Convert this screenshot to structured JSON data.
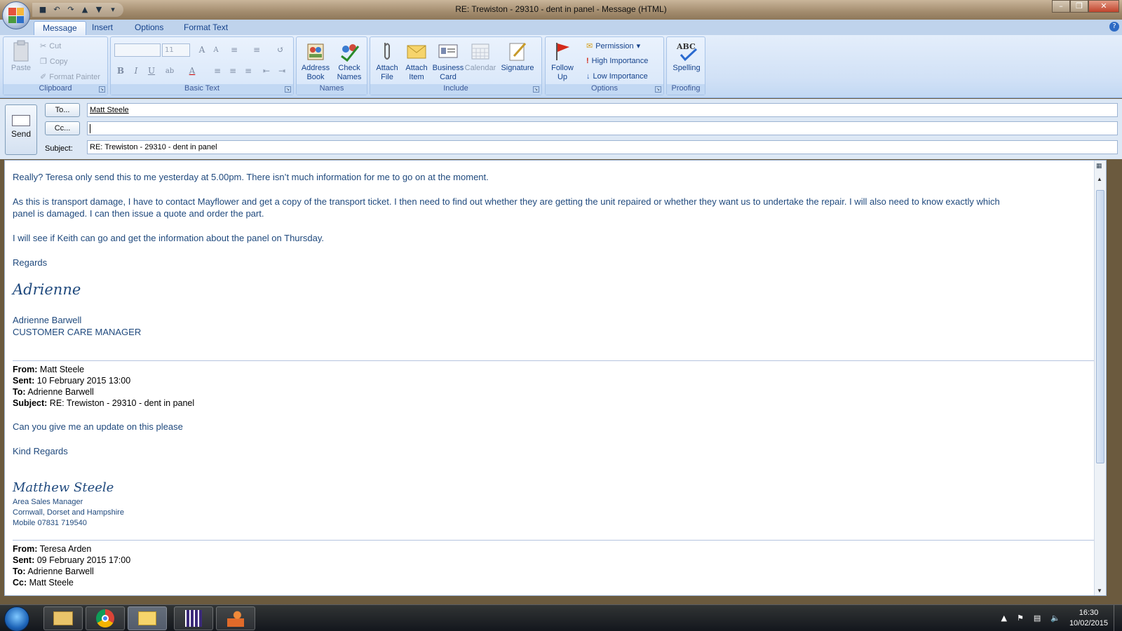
{
  "window": {
    "title": "RE: Trewiston - 29310 - dent in panel - Message (HTML)"
  },
  "tabs": [
    "Message",
    "Insert",
    "Options",
    "Format Text"
  ],
  "ribbon": {
    "clipboard": {
      "label": "Clipboard",
      "paste": "Paste",
      "cut": "Cut",
      "copy": "Copy",
      "format_painter": "Format Painter"
    },
    "basic_text": {
      "label": "Basic Text",
      "font_size": "11"
    },
    "names": {
      "label": "Names",
      "address_book": "Address Book",
      "check_names": "Check Names"
    },
    "include": {
      "label": "Include",
      "attach_file": "Attach File",
      "attach_item": "Attach Item",
      "business_card": "Business Card",
      "calendar": "Calendar",
      "signature": "Signature"
    },
    "options": {
      "label": "Options",
      "follow_up": "Follow Up",
      "permission": "Permission",
      "high_importance": "High Importance",
      "low_importance": "Low Importance"
    },
    "proofing": {
      "label": "Proofing",
      "spelling": "Spelling",
      "abc": "ABC"
    }
  },
  "header": {
    "send": "Send",
    "to_btn": "To...",
    "cc_btn": "Cc...",
    "subject_label": "Subject:",
    "to": "Matt Steele",
    "cc": "",
    "subject": "RE: Trewiston - 29310 - dent in panel"
  },
  "body": {
    "p1": "Really? Teresa only send this to me yesterday at 5.00pm.  There isn’t much information for me to go on  at the moment.",
    "p2a": "As this is transport damage, I have to contact Mayflower and get a copy of the transport ticket.  I then need to find out whether they are getting the unit repaired or whether they want us to undertake the repair.  I will also need to know exactly which",
    "p2b": "panel is damaged.  I can then issue a quote and order the part.",
    "p3": "I will see if Keith can go and get the information about the panel on Thursday.",
    "regards": "Regards",
    "sig_script": "Adrienne",
    "sig_name": "Adrienne Barwell",
    "sig_title": "CUSTOMER CARE MANAGER",
    "q1": {
      "from_l": "From:",
      "from": "Matt Steele",
      "sent_l": "Sent:",
      "sent": "10 February 2015 13:00",
      "to_l": "To:",
      "to": "Adrienne Barwell",
      "subj_l": "Subject:",
      "subj": "RE: Trewiston - 29310 - dent in panel"
    },
    "q1_text": "Can you give me an update on this please",
    "q1_regards": "Kind Regards",
    "q1_sig": "Matthew Steele",
    "q1_role": "Area Sales Manager",
    "q1_area": "Cornwall, Dorset and Hampshire",
    "q1_mobile": "Mobile 07831 719540",
    "q2": {
      "from_l": "From:",
      "from": "Teresa Arden",
      "sent_l": "Sent:",
      "sent": "09 February 2015 17:00",
      "to_l": "To:",
      "to": "Adrienne Barwell",
      "cc_l": "Cc:",
      "cc": "Matt Steele"
    }
  },
  "taskbar": {
    "time": "16:30",
    "date": "10/02/2015"
  }
}
